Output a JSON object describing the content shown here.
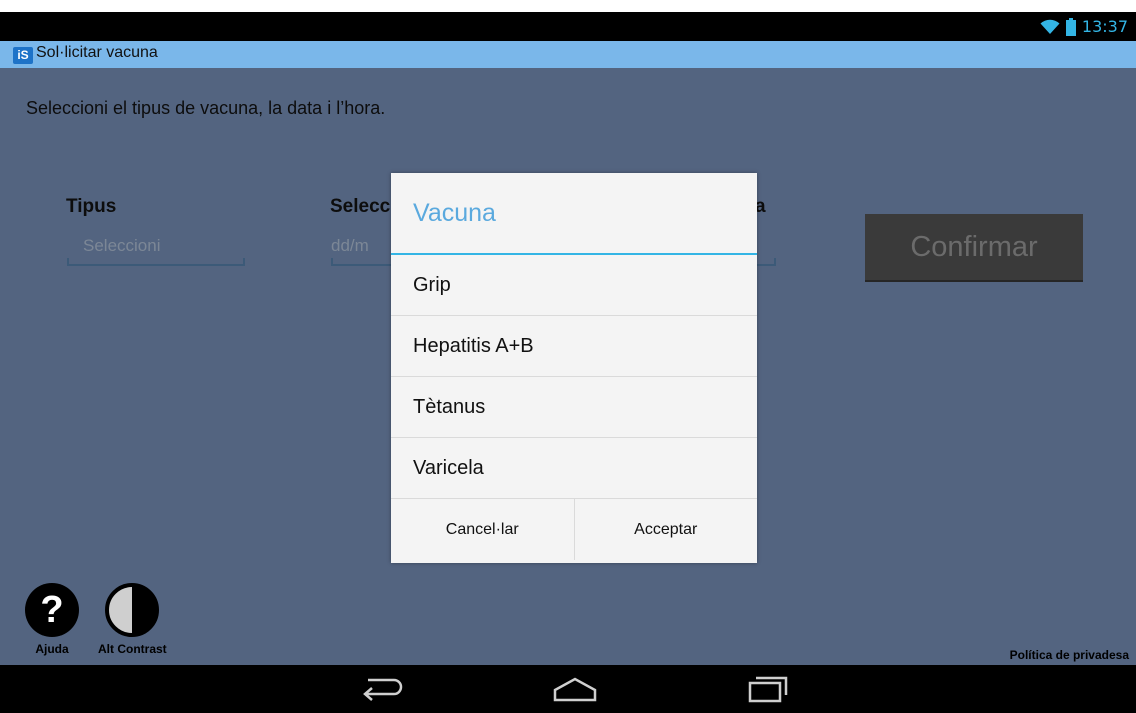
{
  "status_bar": {
    "time": "13:37",
    "icons": [
      "wifi-icon",
      "battery-icon"
    ],
    "accent": "#33b5e5"
  },
  "app_bar": {
    "logo_text": "iS",
    "title": "Sol·licitar vacuna",
    "color": "#7ab7ea"
  },
  "form": {
    "instructions": "Seleccioni el tipus de vacuna, la data i l’hora.",
    "type_label": "Tipus",
    "type_placeholder": "Seleccioni",
    "date_label_visible": "Selecc",
    "date_placeholder_visible": "dd/m",
    "hour_label_visible": "a",
    "confirm_label": "Confirmar"
  },
  "dialog": {
    "title": "Vacuna",
    "options": [
      "Grip",
      "Hepatitis A+B",
      "Tètanus",
      "Varicela"
    ],
    "cancel_label": "Cancel·lar",
    "accept_label": "Acceptar"
  },
  "toolbar": {
    "help_symbol": "?",
    "help_label": "Ajuda",
    "contrast_label": "Alt Contrast",
    "privacy_label": "Política de privadesa"
  },
  "nav_bar": {
    "buttons": [
      "back-icon",
      "home-icon",
      "recent-apps-icon"
    ]
  }
}
